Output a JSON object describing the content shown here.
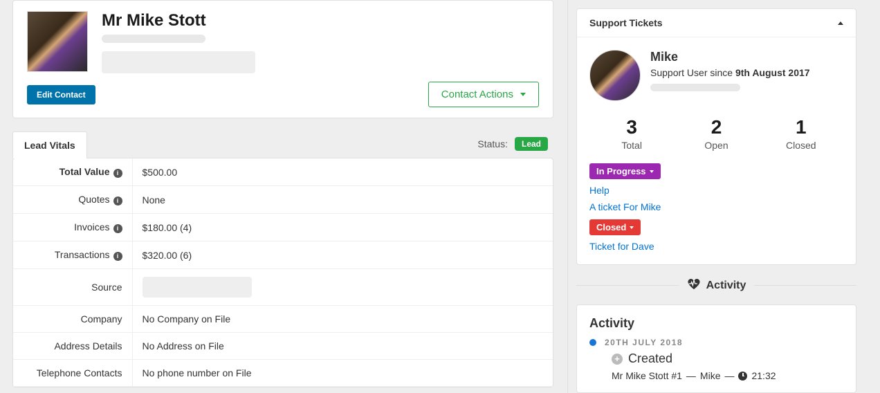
{
  "contact": {
    "name": "Mr Mike Stott",
    "edit_button": "Edit Contact",
    "contact_actions": "Contact Actions"
  },
  "tab": {
    "lead_vitals": "Lead Vitals"
  },
  "status": {
    "label": "Status:",
    "badge": "Lead"
  },
  "vitals": {
    "total_value": {
      "label": "Total Value",
      "value": "$500.00"
    },
    "quotes": {
      "label": "Quotes",
      "value": "None"
    },
    "invoices": {
      "label": "Invoices",
      "value": "$180.00 (4)"
    },
    "transactions": {
      "label": "Transactions",
      "value": "$320.00 (6)"
    },
    "source": {
      "label": "Source"
    },
    "company": {
      "label": "Company",
      "value": "No Company on File"
    },
    "address": {
      "label": "Address Details",
      "value": "No Address on File"
    },
    "telephone": {
      "label": "Telephone Contacts",
      "value": "No phone number on File"
    }
  },
  "support": {
    "header": "Support Tickets",
    "user_name": "Mike",
    "since_prefix": "Support User since ",
    "since_date": "9th August 2017",
    "stats": {
      "total": {
        "num": "3",
        "label": "Total"
      },
      "open": {
        "num": "2",
        "label": "Open"
      },
      "closed": {
        "num": "1",
        "label": "Closed"
      }
    },
    "in_progress_badge": "In Progress",
    "in_progress_links": {
      "a": "Help",
      "b": "A ticket For Mike"
    },
    "closed_badge": "Closed",
    "closed_links": {
      "a": "Ticket for Dave"
    }
  },
  "activity": {
    "divider": "Activity",
    "title": "Activity",
    "date": "20TH JULY 2018",
    "created": "Created",
    "sub_entity": "Mr Mike Stott #1",
    "sub_sep1": "—",
    "sub_user": "Mike",
    "sub_sep2": "—",
    "sub_time": "21:32"
  }
}
